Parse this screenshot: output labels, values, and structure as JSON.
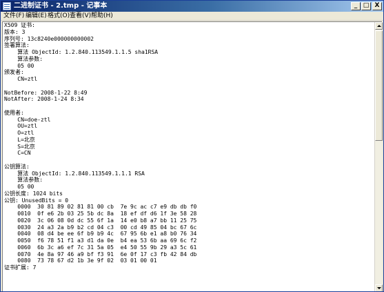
{
  "window": {
    "title": "二进制证书 - 2.tmp - 记事本",
    "minimize_label": "_",
    "maximize_label": "□",
    "close_label": "X"
  },
  "menu": [
    {
      "label": "文件(F)"
    },
    {
      "label": "编辑(E)"
    },
    {
      "label": "格式(O)"
    },
    {
      "label": "查看(V)"
    },
    {
      "label": "帮助(H)"
    }
  ],
  "document": {
    "lines": [
      "X509 证书:",
      "版本: 3",
      "序列号: 13c8240e000000000002",
      "签署算法:",
      "    算法 ObjectId: 1.2.840.113549.1.1.5 sha1RSA",
      "    算法参数:",
      "    05 00",
      "颁发者:",
      "    CN=ztl",
      "",
      "NotBefore: 2008-1-22 8:49",
      "NotAfter: 2008-1-24 8:34",
      "",
      "使用者:",
      "    CN=doe-ztl",
      "    OU=ztl",
      "    O=ztl",
      "    L=北京",
      "    S=北京",
      "    C=CN",
      "",
      "公钥算法:",
      "    算法 ObjectId: 1.2.840.113549.1.1.1 RSA",
      "    算法参数:",
      "    05 00",
      "公钥长度: 1024 bits",
      "公钥: UnusedBits = 0",
      "    0000  30 81 89 02 81 81 00 cb  7e 9c ac c7 e9 db db f0",
      "    0010  0f e6 2b 03 25 5b dc 8a  18 ef df d6 1f 3e 58 28",
      "    0020  3c 06 08 0d dc 55 6f 1a  14 e0 b8 a7 bb 11 25 75",
      "    0030  24 a3 2a b9 b2 cd 04 c3  00 cd 49 85 04 bc 67 6c",
      "    0040  08 d4 be ee 6f b9 b9 4c  67 95 6b e1 a8 b0 76 34",
      "    0050  f6 78 51 f1 a3 d1 da 0e  b4 ea 53 6b aa 69 6c f2",
      "    0060  6b 3c a6 ef 7c 31 5a 05  e4 50 55 9b 29 a3 5c 61",
      "    0070  4e 8a 97 46 a9 bf f3 91  6e 0f 17 c3 fb 42 84 db",
      "    0080  73 78 67 d2 1b 3e 9f 02  03 01 00 01",
      "证书扩展: 7"
    ]
  }
}
